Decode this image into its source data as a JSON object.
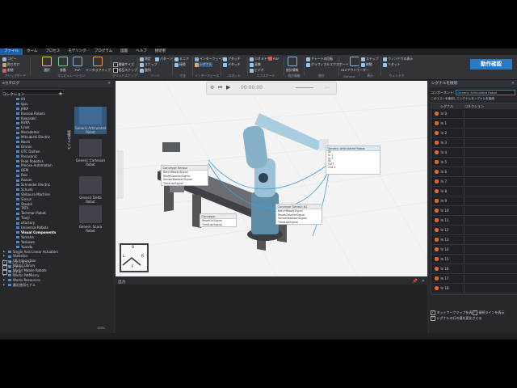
{
  "menubar": {
    "items": [
      "ファイル",
      "ホーム",
      "プロセス",
      "モデリング",
      "プログラム",
      "図面",
      "ヘルプ",
      "接続者"
    ],
    "active_index": 0
  },
  "ribbon": {
    "groups": [
      {
        "title": "クリップボード",
        "items": [
          "コピー",
          "貼り付け",
          "削除"
        ]
      },
      {
        "title": "マニピュレーション",
        "items": [
          "選択",
          "移動",
          "PnP",
          "インタラクティブ"
        ]
      },
      {
        "title": "グリッドスナップ",
        "items": [
          "最後サイズ",
          "相互スナップ",
          "相対"
        ]
      },
      {
        "title": "ツール",
        "items": [
          "測定",
          "スナップ",
          "整列",
          "パターン"
        ]
      },
      {
        "title": "寸法",
        "items": [
          "ミニア",
          "接続"
        ]
      },
      {
        "title": "インターフェース",
        "items": [
          "インターフェース",
          "シグナル"
        ]
      },
      {
        "title": "ロボット",
        "items": [
          "アタッチ",
          "デタッチ"
        ]
      },
      {
        "title": "エクスポート",
        "items": [
          "ジオメトリ",
          "画像",
          "ビデオ",
          "PDF"
        ]
      },
      {
        "title": "統計情報",
        "items": [
          "統計情報",
          "ヘルプ"
        ]
      },
      {
        "title": "統計",
        "items": [
          "チャートの回転",
          "グラフィカルエクスポート",
          "統計"
        ]
      },
      {
        "title": "Genera",
        "items": [
          "OLEアウトポーター"
        ]
      },
      {
        "title": "表示",
        "items": [
          "ステップ",
          "移動"
        ]
      },
      {
        "title": "ウィンドウ",
        "items": [
          "ウィンドウの表示",
          "リセット"
        ]
      }
    ],
    "ops_button": "動作確認"
  },
  "catalog": {
    "title": "eカタログ",
    "collections_label": "コレクション",
    "collections": [
      {
        "label": "IAI",
        "top": false
      },
      {
        "label": "Igus",
        "top": false
      },
      {
        "label": "JAKA",
        "top": false
      },
      {
        "label": "Kassow Robots",
        "top": false
      },
      {
        "label": "Kawasaki",
        "top": false
      },
      {
        "label": "KUKA",
        "top": false
      },
      {
        "label": "Linak",
        "top": false
      },
      {
        "label": "Mecademic",
        "top": false
      },
      {
        "label": "Mitsubishi Electric",
        "top": false
      },
      {
        "label": "Nachi",
        "top": false
      },
      {
        "label": "Omron",
        "top": false
      },
      {
        "label": "OTC Daihen",
        "top": false
      },
      {
        "label": "Panasonic",
        "top": false
      },
      {
        "label": "Peak Robotics",
        "top": false
      },
      {
        "label": "Precise Automation",
        "top": false
      },
      {
        "label": "QEM",
        "top": false
      },
      {
        "label": "Reis",
        "top": false
      },
      {
        "label": "Rozum",
        "top": false
      },
      {
        "label": "Schneider Electric",
        "top": false
      },
      {
        "label": "Schunk",
        "top": false
      },
      {
        "label": "Shibaura Machine",
        "top": false
      },
      {
        "label": "Siasun",
        "top": false
      },
      {
        "label": "Staubli",
        "top": false
      },
      {
        "label": "TATA",
        "top": false
      },
      {
        "label": "Techman Robot",
        "top": false
      },
      {
        "label": "Tianji",
        "top": false
      },
      {
        "label": "uFactory",
        "top": false
      },
      {
        "label": "Universal Robots",
        "top": false
      },
      {
        "label": "Visual Components",
        "top": false,
        "bold": true
      },
      {
        "label": "Yamaha",
        "top": false
      },
      {
        "label": "Yaskawa",
        "top": false
      },
      {
        "label": "Yuanda",
        "top": false
      },
      {
        "label": "Single Axis Linear Actuators",
        "top": true
      },
      {
        "label": "Statistics",
        "top": true
      },
      {
        "label": "VR Interaction",
        "top": true
      },
      {
        "label": "Works Library",
        "top": true
      },
      {
        "label": "Works Mobile Robots",
        "top": true
      },
      {
        "label": "Works PatMissry",
        "top": true
      },
      {
        "label": "Works Resources",
        "top": true
      },
      {
        "label": "最近使用モデル",
        "top": true
      }
    ],
    "bottom_checks": [
      {
        "label": "コンポーネント",
        "checked": true
      },
      {
        "label": "レイアウト",
        "checked": true
      },
      {
        "label": "ファイル",
        "checked": false
      }
    ],
    "vtab_label": "モデルの構成",
    "thumbnails": [
      "Generic Articulated Robot",
      "Generic Cartesian Robot",
      "Generic Delta Robot",
      "Generic Scara Robot"
    ]
  },
  "viewport": {
    "time": "00:00:00",
    "blocks": [
      {
        "title": "Conveyor Sensor",
        "rows": [
          "BatchReadySignal",
          "ResetCounterSignal",
          "SensorBooleanSignal",
          "TimeLapSignal"
        ]
      },
      {
        "title": "Conveyor",
        "rows": [
          "ResetOnSignal",
          "TimeLapSignal"
        ]
      },
      {
        "title": "Conveyor Sensor #2",
        "rows": [
          "BatchReadySignal",
          "ResetCounterSignal",
          "SensorBooleanSignal",
          "TimeLapSignal"
        ]
      },
      {
        "title": "Generic Articulated Robot",
        "rows": [
          "IN",
          "In 1",
          "In 2",
          "IN",
          "OUT",
          "Out 1"
        ]
      }
    ],
    "nav_labels": [
      "B",
      "L",
      "R",
      "F"
    ]
  },
  "output": {
    "title": "出力",
    "zoom": "100%"
  },
  "signals": {
    "title": "シグナルを接続",
    "component_label": "コンポーネント:",
    "component_value": "Generic Articulated Robot",
    "note": "このリストを使用してシグナルをシグナルを接続",
    "col_signal": "シグナル",
    "col_connection": "コネクション",
    "rows": [
      "In 0",
      "In 1",
      "In 2",
      "In 3",
      "In 4",
      "In 5",
      "In 6",
      "In 7",
      "In 8",
      "In 9",
      "In 10",
      "In 11",
      "In 12",
      "In 13",
      "In 14",
      "In 15",
      "In 16",
      "In 17",
      "In 18"
    ],
    "bottom_checks": [
      {
        "label": "ネットワークマップを表示",
        "checked": true
      },
      {
        "label": "接続ラインを表示",
        "checked": true
      },
      {
        "label": "シグナルの行の値を変化させる",
        "checked": true
      }
    ]
  },
  "colors": {
    "accent": "#2a78c6",
    "signal_dot": "#e06a2c",
    "panel_bg": "#26282b",
    "viewport_bg": "#f3f3f3"
  }
}
